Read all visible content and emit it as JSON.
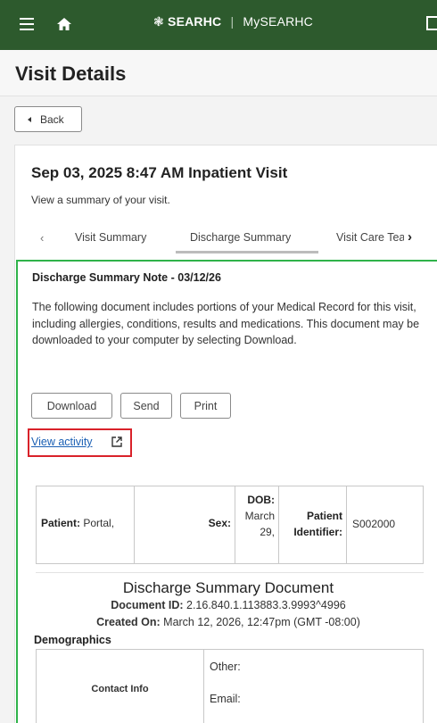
{
  "header": {
    "brand": "SEARHC",
    "separator": "|",
    "app": "MySEARHC"
  },
  "page": {
    "title": "Visit Details",
    "back_label": "Back"
  },
  "visit": {
    "title": "Sep 03, 2025 8:47 AM Inpatient Visit",
    "subtitle": "View a summary of your visit."
  },
  "tabs": {
    "prev": "‹",
    "next": "›",
    "items": [
      {
        "label": "Visit Summary"
      },
      {
        "label": "Discharge Summary"
      },
      {
        "label": "Visit Care Team"
      }
    ]
  },
  "note": {
    "title": "Discharge Summary Note - 03/12/26",
    "body": "The following document includes portions of your Medical Record for this visit, including allergies, conditions, results and medications. This document may be downloaded to your computer by selecting Download.",
    "download_label": "Download",
    "send_label": "Send",
    "print_label": "Print",
    "view_activity_label": "View activity"
  },
  "patient": {
    "patient_label": "Patient:",
    "patient_value": "Portal,",
    "sex_label": "Sex:",
    "dob_label": "DOB:",
    "dob_line1": "March",
    "dob_line2": "29,",
    "identifier_label_1": "Patient",
    "identifier_label_2": "Identifier:",
    "identifier_value": "S002000"
  },
  "document": {
    "heading": "Discharge Summary Document",
    "id_label": "Document ID:",
    "id_value": "2.16.840.1.113883.3.9993^4996",
    "created_label": "Created On:",
    "created_value": "March 12, 2026, 12:47pm (GMT -08:00)",
    "demographics_title": "Demographics",
    "contact_label": "Contact Info",
    "other_label": "Other:",
    "email_label": "Email:"
  },
  "colors": {
    "header_bg": "#2d5a2d",
    "note_border": "#2fb34a",
    "highlight_border": "#d9222a",
    "link": "#1a5fb4"
  }
}
